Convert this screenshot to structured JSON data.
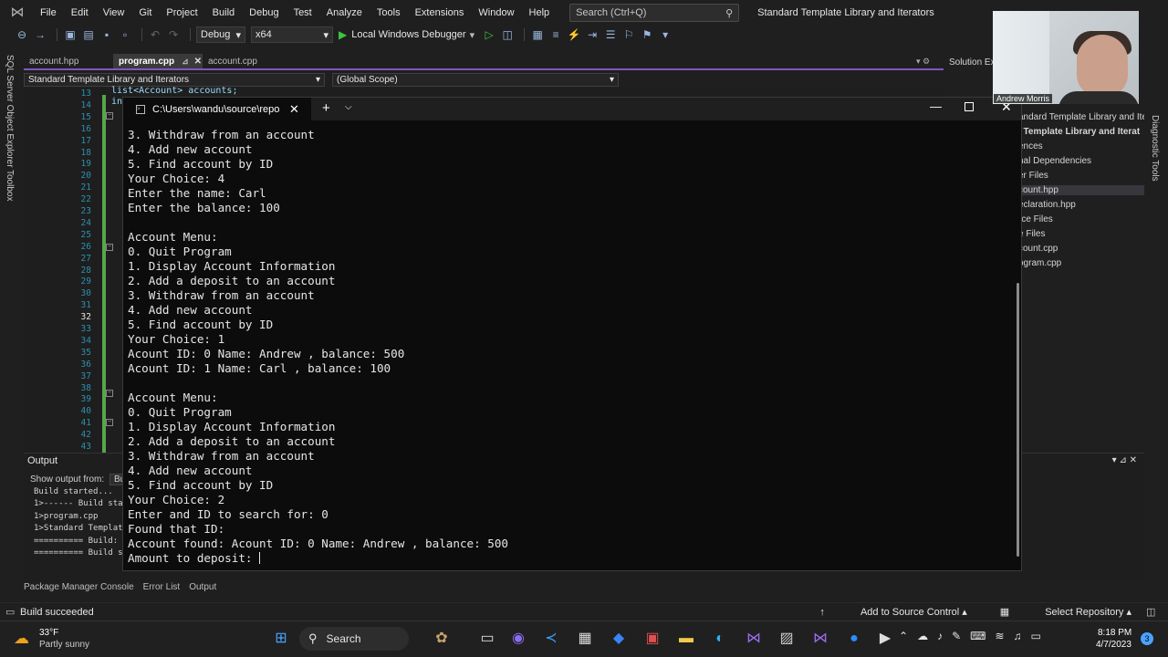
{
  "menubar": {
    "items": [
      "File",
      "Edit",
      "View",
      "Git",
      "Project",
      "Build",
      "Debug",
      "Test",
      "Analyze",
      "Tools",
      "Extensions",
      "Window",
      "Help"
    ],
    "search_placeholder": "Search (Ctrl+Q)",
    "solution_title": "Standard Template Library and Iterators"
  },
  "toolbar": {
    "config": "Debug",
    "platform": "x64",
    "run_label": "Local Windows Debugger"
  },
  "left_strip": {
    "sql_explorer": "SQL Server Object Explorer",
    "toolbox": "Toolbox"
  },
  "doc_tabs": [
    {
      "label": "account.hpp"
    },
    {
      "label": "program.cpp"
    },
    {
      "label": "account.cpp"
    }
  ],
  "navbar": {
    "project": "Standard Template Library and Iterators",
    "scope": "(Global Scope)"
  },
  "editor": {
    "line_numbers": [
      "13",
      "14",
      "15",
      "16",
      "17",
      "18",
      "19",
      "20",
      "21",
      "22",
      "23",
      "24",
      "25",
      "26",
      "27",
      "28",
      "29",
      "30",
      "31",
      "32",
      "33",
      "34",
      "35",
      "36",
      "37",
      "38",
      "39",
      "40",
      "41",
      "42",
      "43"
    ],
    "current_line": "32",
    "frag1": "list<Account> accounts;",
    "frag2": "in"
  },
  "solution_explorer": {
    "title": "Solution Ex",
    "items": [
      {
        "label": "andard Template Library and Ite",
        "bold": false,
        "sel": false
      },
      {
        "label": "l Template Library and Iterat",
        "bold": true,
        "sel": false
      },
      {
        "label": "ences",
        "bold": false,
        "sel": false
      },
      {
        "label": "nal Dependencies",
        "bold": false,
        "sel": false
      },
      {
        "label": "er Files",
        "bold": false,
        "sel": false
      },
      {
        "label": "count.hpp",
        "bold": false,
        "sel": true
      },
      {
        "label": "eclaration.hpp",
        "bold": false,
        "sel": false
      },
      {
        "label": "rce Files",
        "bold": false,
        "sel": false
      },
      {
        "label": "e Files",
        "bold": false,
        "sel": false
      },
      {
        "label": "count.cpp",
        "bold": false,
        "sel": false
      },
      {
        "label": "ogram.cpp",
        "bold": false,
        "sel": false
      }
    ],
    "diagnostic_tools": "Diagnostic Tools"
  },
  "output": {
    "title": "Output",
    "show_from": "Show output from:",
    "show_from_value": "Bu",
    "lines": [
      "Build started...",
      "1>------ Build sta",
      "1>program.cpp",
      "1>Standard Templat",
      "========== Build:",
      "========== Build s"
    ]
  },
  "bottom_tabs": [
    "Package Manager Console",
    "Error List",
    "Output"
  ],
  "statusbar": {
    "build": "Build succeeded",
    "source_control": "Add to Source Control",
    "repository": "Select Repository"
  },
  "terminal": {
    "tab_title": "C:\\Users\\wandu\\source\\repos",
    "lines": [
      "3. Withdraw from an account",
      "4. Add new account",
      "5. Find account by ID",
      "Your Choice: 4",
      "Enter the name: Carl",
      "Enter the balance: 100",
      "",
      "Account Menu:",
      "0. Quit Program",
      "1. Display Account Information",
      "2. Add a deposit to an account",
      "3. Withdraw from an account",
      "4. Add new account",
      "5. Find account by ID",
      "Your Choice: 1",
      "Acount ID: 0 Name: Andrew , balance: 500",
      "Acount ID: 1 Name: Carl , balance: 100",
      "",
      "Account Menu:",
      "0. Quit Program",
      "1. Display Account Information",
      "2. Add a deposit to an account",
      "3. Withdraw from an account",
      "4. Add new account",
      "5. Find account by ID",
      "Your Choice: 2",
      "Enter and ID to search for: 0",
      "Found that ID:",
      "Account found: Acount ID: 0 Name: Andrew , balance: 500"
    ],
    "prompt_line": "Amount to deposit: "
  },
  "webcam": {
    "name": "Andrew Morris"
  },
  "taskbar": {
    "temp": "33°F",
    "weather": "Partly sunny",
    "search_label": "Search",
    "time": "8:18 PM",
    "date": "4/7/2023",
    "notif_count": "3"
  }
}
